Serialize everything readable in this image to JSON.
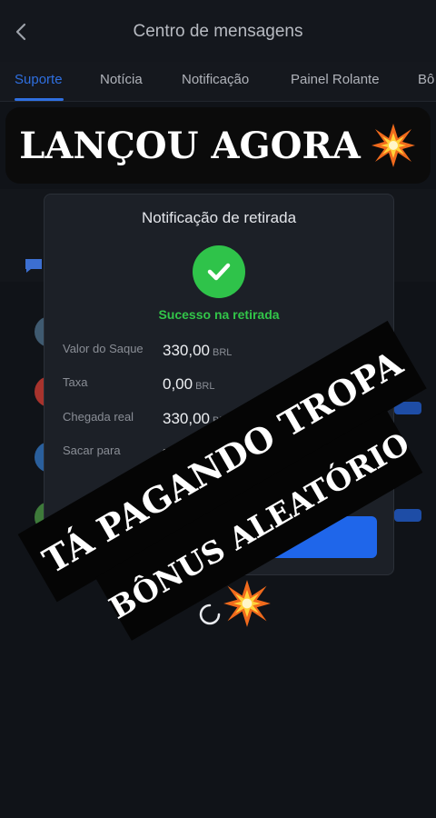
{
  "header": {
    "title": "Centro de mensagens"
  },
  "tabs": [
    {
      "label": "Suporte",
      "active": true
    },
    {
      "label": "Notícia",
      "active": false
    },
    {
      "label": "Notificação",
      "active": false
    },
    {
      "label": "Painel Rolante",
      "active": false
    },
    {
      "label": "Bô",
      "active": false
    }
  ],
  "banner_top": {
    "text": "LANÇOU AGORA"
  },
  "modal": {
    "title": "Notificação de retirada",
    "status": "Sucesso na retirada",
    "rows": [
      {
        "label": "Valor do Saque",
        "value": "330,00",
        "currency": "BRL"
      },
      {
        "label": "Taxa",
        "value": "0,00",
        "currency": "BRL"
      },
      {
        "label": "Chegada real",
        "value": "330,00",
        "currency": "BRL"
      },
      {
        "label": "Sacar para"
      }
    ]
  },
  "banner_diagonal": {
    "line1": "TÁ PAGANDO TROPA",
    "line2": "BÔNUS ALEATÓRIO"
  },
  "colors": {
    "accent": "#2f6fe0",
    "success": "#32c549",
    "background": "#101318",
    "modal": "#1c2027"
  },
  "icons": [
    "chevron-left-icon",
    "check-icon",
    "explosion-icon",
    "chat-icon",
    "bank-icon",
    "loading-spinner-icon"
  ]
}
